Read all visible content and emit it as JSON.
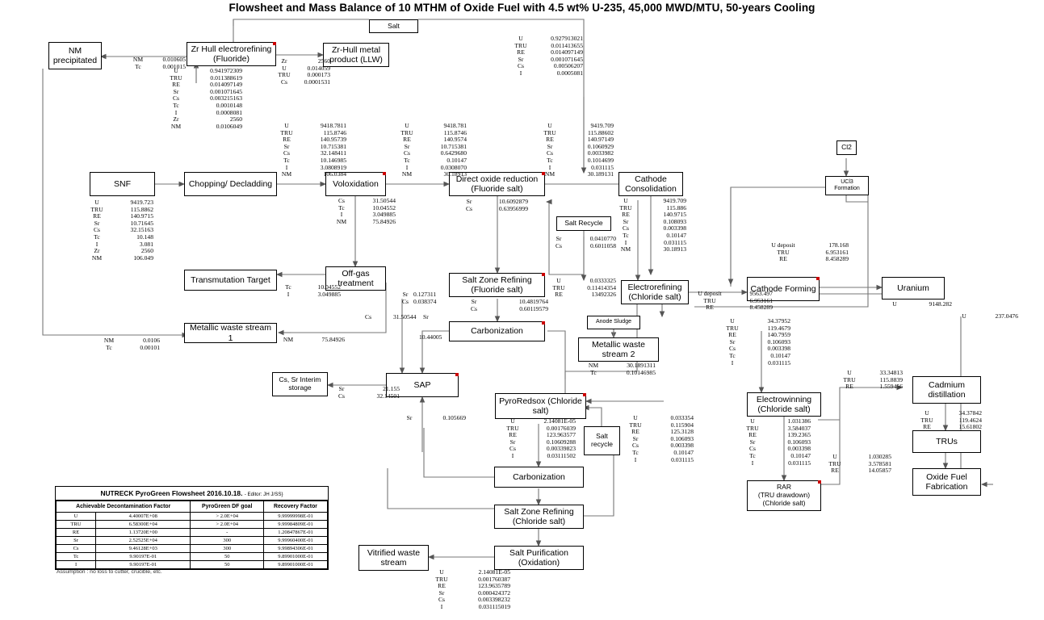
{
  "title": "Flowsheet and Mass Balance of 10 MTHM of Oxide Fuel with 4.5 wt% U-235, 45,000 MWD/MTU, 50-years Cooling",
  "boxes": {
    "salt": "Salt",
    "nm_precipitated": "NM\nprecipitated",
    "zr_hull_electrorefining": "Zr Hull electrorefining\n(Fluoride)",
    "zr_hull_metal_product": "Zr-Hull metal\nproduct (LLW)",
    "snf": "SNF",
    "chopping_decladding": "Chopping/ Decladding",
    "voloxidation": "Voloxidation",
    "direct_oxide_reduction": "Direct oxide reduction\n(Fluoride salt)",
    "cathode_consolidation": "Cathode\nConsolidation",
    "cl2": "Cl2",
    "ucl3_formation": "UCl3\nFormation",
    "salt_recycle_top": "Salt Recycle",
    "electrorefining_chloride": "Electrorefining\n(Chloride salt)",
    "cathode_forming": "Cathode Forming",
    "uranium": "Uranium",
    "transmutation_target": "Transmutation Target",
    "off_gas_treatment": "Off-gas\ntreatment",
    "metallic_waste_stream_1": "Metallic waste stream 1",
    "salt_zone_refining_fluoride": "Salt Zone Refining\n(Fluoride salt)",
    "carbonization_1": "Carbonization",
    "anode_sludge": "Anode Sludge",
    "metallic_waste_stream_2": "Metallic waste\nstream 2",
    "cs_sr_interim_storage": "Cs, Sr Interim\nstorage",
    "sap": "SAP",
    "pyroredsox": "PyroRedsox (Chloride\nsalt)",
    "salt_recycle_bottom": "Salt\nrecycle",
    "electrowinning": "Electrowinning\n(Chloride salt)",
    "rar": "RAR\n(TRU drawdown)\n(Chloride salt)",
    "cadmium_distillation": "Cadmium\ndistillation",
    "trus": "TRUs",
    "oxide_fuel_fabrication": "Oxide Fuel\nFabrication",
    "carbonization_2": "Carbonization",
    "salt_zone_refining_chloride": "Salt Zone Refining\n(Chloride salt)",
    "salt_purification": "Salt Purification\n(Oxidation)",
    "vitrified_waste_stream": "Vitrified waste\nstream"
  },
  "streams": {
    "nm_tc_to_precipitated": {
      "keys": [
        "NM",
        "Tc"
      ],
      "values": [
        "0.010605",
        "0.001015"
      ]
    },
    "zr_hull_er_out": {
      "keys": [
        "U",
        "TRU",
        "RE",
        "Sr",
        "Cs",
        "Tc",
        "I",
        "Zr",
        "NM"
      ],
      "values": [
        "0.941972309",
        "0.011388619",
        "0.014097149",
        "0.001071645",
        "0.003215163",
        "0.0010148",
        "0.0008081",
        "2560",
        "0.0106049"
      ]
    },
    "zr_hull_metal": {
      "keys": [
        "Zr",
        "U",
        "TRU",
        "Cs"
      ],
      "values": [
        "2560",
        "0.014059",
        "0.000173",
        "0.0001531"
      ]
    },
    "salt_stream_top": {
      "keys": [
        "U",
        "TRU",
        "RE",
        "Sr",
        "Cs",
        "I"
      ],
      "values": [
        "0.927913021",
        "0.011413655",
        "0.014097149",
        "0.001071645",
        "0.00506207",
        "0.0005081"
      ]
    },
    "snf": {
      "keys": [
        "U",
        "TRU",
        "RE",
        "Sr",
        "Cs",
        "Tc",
        "I",
        "Zr",
        "NM"
      ],
      "values": [
        "9419.723",
        "115.8862",
        "140.9715",
        "10.71645",
        "32.15163",
        "10.148",
        "3.081",
        "2560",
        "106.049"
      ]
    },
    "chopping_out": {
      "keys": [
        "U",
        "TRU",
        "RE",
        "Sr",
        "Cs",
        "Tc",
        "I",
        "NM"
      ],
      "values": [
        "9418.7811",
        "115.8746",
        "140.95739",
        "10.715381",
        "32.148411",
        "10.146985",
        "3.0808919",
        "106.0384"
      ]
    },
    "volox_out": {
      "keys": [
        "U",
        "TRU",
        "RE",
        "Sr",
        "Cs",
        "Tc",
        "I",
        "NM"
      ],
      "values": [
        "9418.781",
        "115.8746",
        "140.9574",
        "10.715381",
        "0.6429680",
        "0.10147",
        "0.0308070",
        "30.18913"
      ]
    },
    "volox_down": {
      "keys": [
        "Cs",
        "Tc",
        "I",
        "NM"
      ],
      "values": [
        "31.50544",
        "10.04552",
        "3.049885",
        "75.84926"
      ]
    },
    "dor_down": {
      "keys": [
        "Sr",
        "Cs"
      ],
      "values": [
        "10.6092879",
        "0.63956999"
      ]
    },
    "dor_out": {
      "keys": [
        "U",
        "TRU",
        "RE",
        "Sr",
        "Cs",
        "Tc",
        "I",
        "NM"
      ],
      "values": [
        "9419.709",
        "115.88602",
        "140.97149",
        "0.1060929",
        "0.0033982",
        "0.1014699",
        "0.031115",
        "30.189131"
      ]
    },
    "cathode_cons_out": {
      "keys": [
        "U",
        "TRU",
        "RE",
        "Sr",
        "Cs",
        "Tc",
        "I",
        "NM"
      ],
      "values": [
        "9419.709",
        "115.886",
        "140.9715",
        "0.108093",
        "0.003398",
        "0.10147",
        "0.031115",
        "30.18913"
      ]
    },
    "salt_recycle_top": {
      "keys": [
        "Sr",
        "Cs"
      ],
      "values": [
        "0.0410770",
        "0.6011058"
      ]
    },
    "er_chloride_in_left": {
      "keys": [
        "U",
        "TRU",
        "RE"
      ],
      "values": [
        "0.0333325",
        "0.11414354",
        "13492326"
      ]
    },
    "u_deposit_to_cathode_forming": {
      "keys": [
        "U deposit",
        "TRU",
        "RE"
      ],
      "values": [
        "178.168",
        "6.953161",
        "8.458289"
      ]
    },
    "u_deposit_cathode_forming_out": {
      "keys": [
        "U deposit",
        "TRU",
        "RE"
      ],
      "values": [
        "9563.497",
        "6.953161",
        "8.458289"
      ]
    },
    "uranium": {
      "keys": [
        "U"
      ],
      "values": [
        "9148.282"
      ]
    },
    "far_right_u": {
      "keys": [
        "U"
      ],
      "values": [
        "237.0476"
      ]
    },
    "offgas_to_transmutation": {
      "keys": [
        "Tc",
        "I"
      ],
      "values": [
        "10.04552",
        "3.049885"
      ]
    },
    "offgas_cs": {
      "keys": [
        "Cs"
      ],
      "values": [
        ""
      ]
    },
    "metallic_waste_1_nm": {
      "keys": [
        "NM"
      ],
      "values": [
        "75.84926"
      ]
    },
    "mws1_in": {
      "keys": [
        "NM",
        "Tc"
      ],
      "values": [
        "0.0106",
        "0.00101"
      ]
    },
    "szr_fluoride_left": {
      "keys": [
        "Sr",
        "Cs"
      ],
      "values": [
        "0.127311",
        "0.038374"
      ]
    },
    "szr_fluoride_out": {
      "keys": [
        "Sr",
        "Cs"
      ],
      "values": [
        "10.4819764",
        "0.60119579"
      ]
    },
    "carbonization_1_sr": {
      "keys": [
        "Sr"
      ],
      "values": [
        "10.44005"
      ]
    },
    "cs_31_50544": {
      "keys": [
        "Cs"
      ],
      "values": [
        "31.50544"
      ]
    },
    "sap_to_storage": {
      "keys": [
        "Sr",
        "Cs"
      ],
      "values": [
        "21.155",
        "32.14501"
      ]
    },
    "sap_in_sr": {
      "keys": [
        "Sr"
      ],
      "values": [
        "0.105669"
      ]
    },
    "mws2": {
      "keys": [
        "NM",
        "Tc"
      ],
      "values": [
        "30.1891311",
        "0.10146985"
      ]
    },
    "pyroredsox_out": {
      "keys": [
        "U",
        "TRU",
        "RE",
        "Sr",
        "Cs",
        "I"
      ],
      "values": [
        "2.14081E-05",
        "0.00176039",
        "123.963577",
        "0.10609288",
        "0.00339823",
        "0.03111502"
      ]
    },
    "pyroredsox_in_right": {
      "keys": [
        "U",
        "TRU",
        "RE",
        "Sr",
        "Cs",
        "Tc",
        "I"
      ],
      "values": [
        "0.033354",
        "0.115904",
        "125.3128",
        "0.106093",
        "0.003398",
        "0.10147",
        "0.031115"
      ]
    },
    "electrowinning_in": {
      "keys": [
        "U",
        "TRU",
        "RE",
        "Sr",
        "Cs",
        "Tc",
        "I"
      ],
      "values": [
        "34.37952",
        "119.4679",
        "140.7959",
        "0.106093",
        "0.003398",
        "0.10147",
        "0.031115"
      ]
    },
    "electrowinning_out": {
      "keys": [
        "U",
        "TRU",
        "RE",
        "Sr",
        "Cs",
        "Tc",
        "I"
      ],
      "values": [
        "1.031386",
        "3.584037",
        "139.2365",
        "0.106093",
        "0.003398",
        "0.10147",
        "0.031115"
      ]
    },
    "rar_right": {
      "keys": [
        "U",
        "TRU",
        "RE"
      ],
      "values": [
        "1.030285",
        "3.578581",
        "14.05857"
      ]
    },
    "to_cadmium": {
      "keys": [
        "U",
        "TRU",
        "RE"
      ],
      "values": [
        "33.34813",
        "115.8839",
        "1.559456"
      ]
    },
    "cadmium_out": {
      "keys": [
        "U",
        "TRU",
        "RE"
      ],
      "values": [
        "34.37842",
        "119.4624",
        "15.61802"
      ]
    },
    "vitrified_waste": {
      "keys": [
        "U",
        "TRU",
        "RE",
        "Sr",
        "Cs",
        "I"
      ],
      "values": [
        "2.14081E-05",
        "0.001760387",
        "123.9635789",
        "0.000424372",
        "0.003398232",
        "0.031115019"
      ]
    }
  },
  "decon_table": {
    "caption": "NUTRECK PyroGreen Flowsheet 2016.10.18.",
    "editor": "- Editor: JH J/SS}",
    "columns": [
      "Achievable Decontamination Factor",
      "PyroGreen DF goal",
      "Recovery Factor"
    ],
    "rows": [
      {
        "element": "U",
        "adf": "4.40007E+08",
        "goal": "> 2.0E+04",
        "rf": "9.99999998E-01"
      },
      {
        "element": "TRU",
        "adf": "6.58300E+04",
        "goal": "> 2.0E+04",
        "rf": "9.99984809E-01"
      },
      {
        "element": "RE",
        "adf": "1.13720E+00",
        "goal": "-",
        "rf": "1.20847867E-01"
      },
      {
        "element": "Sr",
        "adf": "2.52525E+04",
        "goal": "300",
        "rf": "9.99960400E-01"
      },
      {
        "element": "Cs",
        "adf": "9.46128E+03",
        "goal": "300",
        "rf": "9.99894306E-01"
      },
      {
        "element": "Tc",
        "adf": "9.90197E-01",
        "goal": "50",
        "rf": "9.89901000E-01"
      },
      {
        "element": "I",
        "adf": "9.90197E-01",
        "goal": "50",
        "rf": "9.89901000E-01"
      }
    ],
    "assumption": "Assumption : no loss to cutter, crucible, etc."
  },
  "colors": {
    "line": "#6b6b6b",
    "border": "#000000",
    "accent": "#cc0000"
  }
}
